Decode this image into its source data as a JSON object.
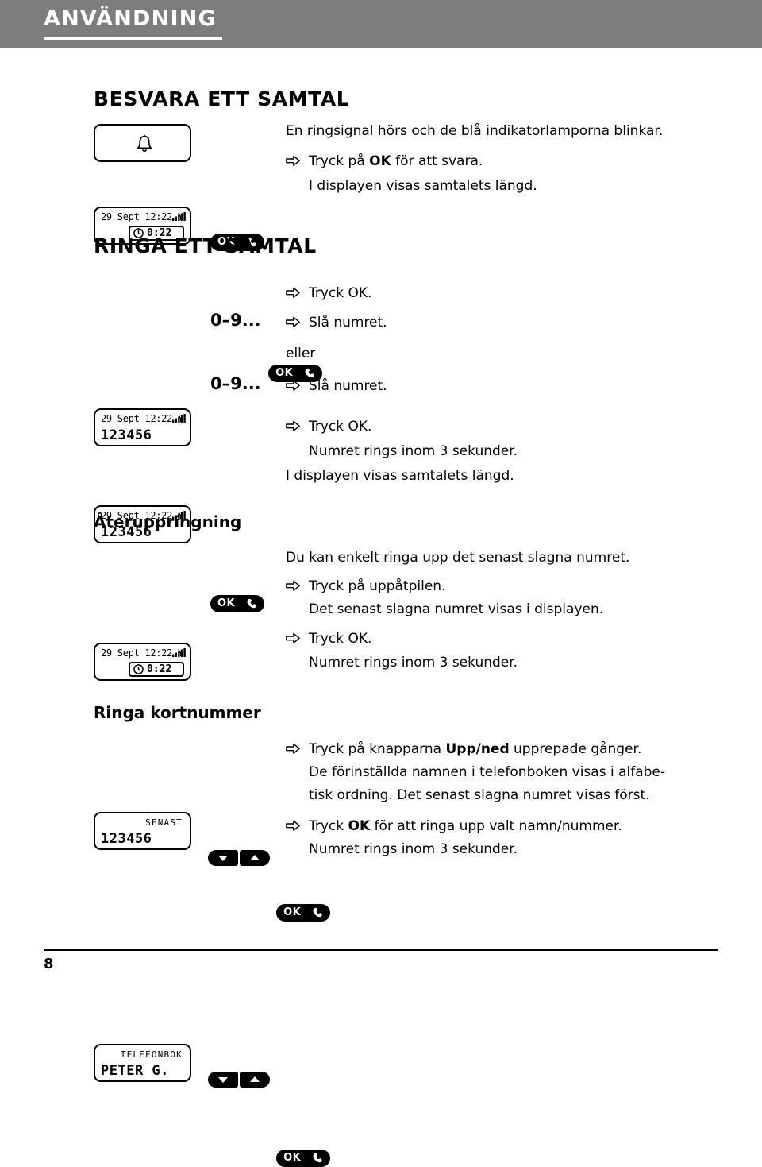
{
  "header": {
    "title": "ANVÄNDNING"
  },
  "sections": {
    "answer_call": {
      "title": "BESVARA ETT SAMTAL",
      "lines": [
        "En ringsignal hörs och de blå indikatorlamporna blinkar.",
        "Tryck på OK för att svara.",
        "I displayen visas samtalets längd."
      ],
      "step_bold": "OK",
      "step_prefix": "Tryck på ",
      "step_suffix": " för att svara.",
      "key_label": "OK"
    },
    "make_call": {
      "title": "RINGA ETT SAMTAL",
      "key_label": "OK",
      "step1": "Tryck OK.",
      "step1_bold": "OK",
      "dial_label": "0–9...",
      "step2": "Slå numret.",
      "or_label": "eller",
      "step3": "Slå numret.",
      "step4": "Tryck OK.",
      "step5": "Numret rings inom 3 sekunder.",
      "step6": "I displayen visas samtalets längd."
    },
    "redial": {
      "title": "Återuppringning",
      "intro": "Du kan enkelt ringa upp det senast slagna numret.",
      "step1": "Tryck på uppåtpilen.",
      "step2": "Det senast slagna numret visas i displayen.",
      "step3": "Tryck OK.",
      "step3_bold": "OK",
      "step4": "Numret rings inom 3 sekunder."
    },
    "speeddial": {
      "title": "Ringa kortnummer",
      "step1_pre": "Tryck på knapparna ",
      "step1_bold": "Upp/ned",
      "step1_post": " upprepade gånger.",
      "step2": "De förinställda namnen i telefonboken visas i alfabe-",
      "step3": "tisk ordning. Det senast slagna numret visas först.",
      "step4_pre": "Tryck ",
      "step4_bold": "OK",
      "step4_post": " för att ringa upp valt namn/nummer.",
      "step5": "Numret rings inom 3 sekunder."
    }
  },
  "displays": {
    "bell": {
      "icon": "bell-icon"
    },
    "call_timer_1": {
      "status": "29 Sept 12:22  Y",
      "timer": "0:22"
    },
    "number_1": {
      "status": "29 Sept 12:22  Y",
      "number": "123456"
    },
    "number_2": {
      "status": "29 Sept 12:22  Y",
      "number": "123456"
    },
    "call_timer_2": {
      "status": "29 Sept 12:22  Y",
      "timer": "0:22"
    },
    "redial_display": {
      "label": "SENAST",
      "number": "123456"
    },
    "phonebook_display": {
      "label": "TELEFONBOK",
      "name": "PETER G."
    }
  },
  "footer": {
    "page_number": "8"
  },
  "colors": {
    "header_bg": "#7d7d7d",
    "text": "#000000",
    "key_bg": "#000000"
  }
}
